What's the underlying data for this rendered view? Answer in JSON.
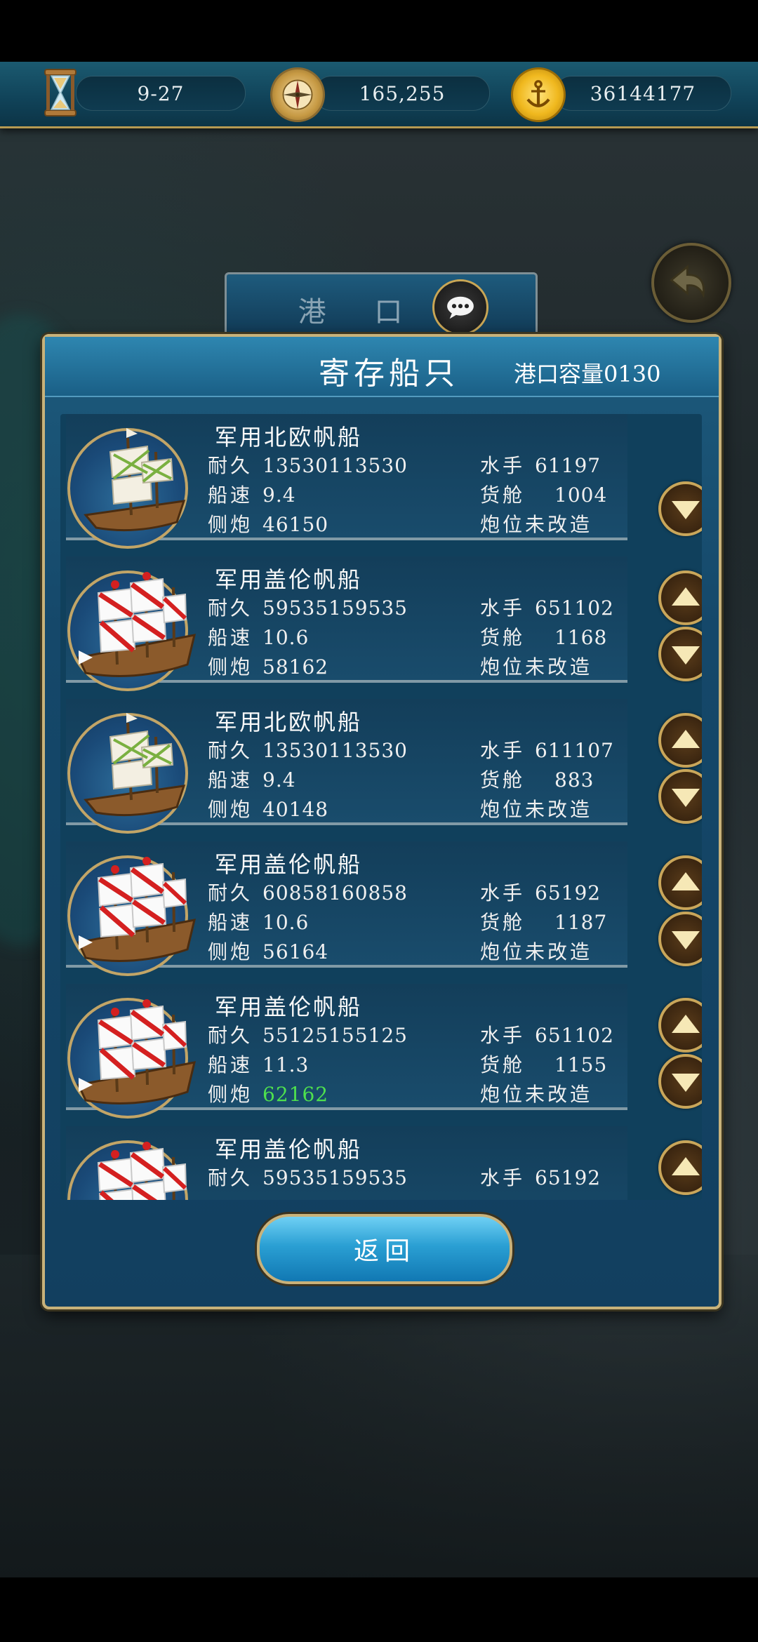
{
  "topbar": {
    "date": "9-27",
    "compass_value": "165,255",
    "gold": "36144177",
    "icons": [
      "hourglass-icon",
      "compass-icon",
      "anchor-coin-icon"
    ]
  },
  "port_tab": {
    "title": "港 口"
  },
  "panel": {
    "title": "寄存船只",
    "capacity": "港口容量0130",
    "return_label": "返回"
  },
  "ships": [
    {
      "name": "军用北欧帆船",
      "durability": "13530113530",
      "speed": "9.4",
      "cannons": "46150",
      "sailors": "61197",
      "cargo": "1004",
      "modification": "炮位未改造",
      "type": "nordic",
      "up": false,
      "down": true,
      "cannon_color": "#f0f0f0"
    },
    {
      "name": "军用盖伦帆船",
      "durability": "59535159535",
      "speed": "10.6",
      "cannons": "58162",
      "sailors": "651102",
      "cargo": "1168",
      "modification": "炮位未改造",
      "type": "galleon",
      "up": true,
      "down": true,
      "cannon_color": "#f0f0f0"
    },
    {
      "name": "军用北欧帆船",
      "durability": "13530113530",
      "speed": "9.4",
      "cannons": "40148",
      "sailors": "611107",
      "cargo": "883",
      "modification": "炮位未改造",
      "type": "nordic",
      "up": true,
      "down": true,
      "cannon_color": "#f0f0f0"
    },
    {
      "name": "军用盖伦帆船",
      "durability": "60858160858",
      "speed": "10.6",
      "cannons": "56164",
      "sailors": "65192",
      "cargo": "1187",
      "modification": "炮位未改造",
      "type": "galleon",
      "up": true,
      "down": true,
      "cannon_color": "#f0f0f0"
    },
    {
      "name": "军用盖伦帆船",
      "durability": "55125155125",
      "speed": "11.3",
      "cannons": "62162",
      "sailors": "651102",
      "cargo": "1155",
      "modification": "炮位未改造",
      "type": "galleon",
      "up": true,
      "down": true,
      "cannon_color": "#4ee04e"
    },
    {
      "name": "军用盖伦帆船",
      "durability": "59535159535",
      "speed": "",
      "cannons": "",
      "sailors": "65192",
      "cargo": "",
      "modification": "",
      "type": "galleon",
      "up": true,
      "down": false,
      "cannon_color": "#f0f0f0"
    }
  ],
  "labels": {
    "durability": "耐久",
    "speed": "船速",
    "cannons": "侧炮",
    "sailors": "水手",
    "cargo": "货舱"
  },
  "colors": {
    "panel_border": "#c8b27a",
    "header_blue": "#2e86b0",
    "highlight_green": "#4ee04e"
  }
}
